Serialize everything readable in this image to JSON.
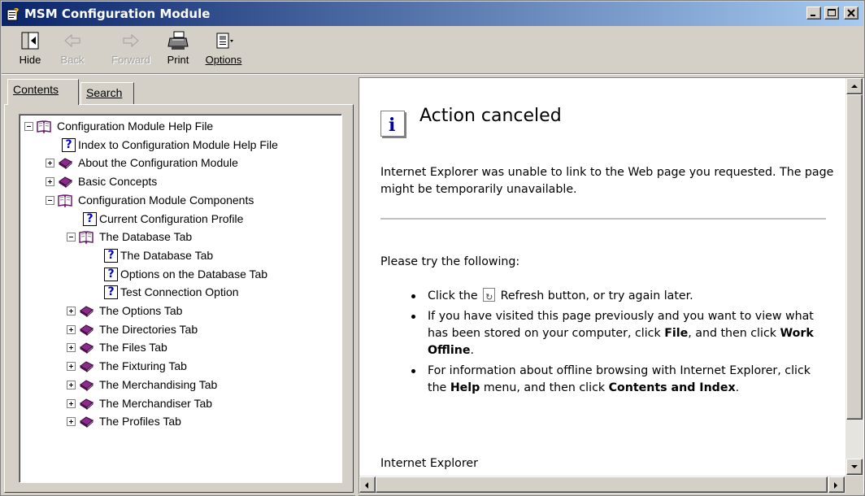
{
  "window": {
    "title": "MSM Configuration Module"
  },
  "toolbar": {
    "hide": "Hide",
    "back": "Back",
    "forward": "Forward",
    "print": "Print",
    "options": "Options"
  },
  "tabs": {
    "contents": "Contents",
    "search": "Search"
  },
  "tree": [
    {
      "label": "Configuration Module Help File",
      "level": 0,
      "icon": "open-book-icon",
      "expander": "minus"
    },
    {
      "label": "Index to Configuration  Module Help File",
      "level": 1,
      "icon": "help-topic-icon",
      "expander": "none"
    },
    {
      "label": "About the Configuration Module",
      "level": 1,
      "icon": "closed-book-icon",
      "expander": "plus"
    },
    {
      "label": "Basic Concepts",
      "level": 1,
      "icon": "closed-book-icon",
      "expander": "plus"
    },
    {
      "label": "Configuration Module Components",
      "level": 1,
      "icon": "open-book-icon",
      "expander": "minus"
    },
    {
      "label": "Current Configuration Profile",
      "level": 2,
      "icon": "help-topic-icon",
      "expander": "none"
    },
    {
      "label": "The Database Tab",
      "level": 2,
      "icon": "open-book-icon",
      "expander": "minus"
    },
    {
      "label": "The Database Tab",
      "level": 3,
      "icon": "help-topic-icon",
      "expander": "none"
    },
    {
      "label": "Options on the Database Tab",
      "level": 3,
      "icon": "help-topic-icon",
      "expander": "none"
    },
    {
      "label": "Test Connection Option",
      "level": 3,
      "icon": "help-topic-icon",
      "expander": "none"
    },
    {
      "label": "The Options Tab",
      "level": 2,
      "icon": "closed-book-icon",
      "expander": "plus"
    },
    {
      "label": "The Directories Tab",
      "level": 2,
      "icon": "closed-book-icon",
      "expander": "plus"
    },
    {
      "label": "The Files Tab",
      "level": 2,
      "icon": "closed-book-icon",
      "expander": "plus"
    },
    {
      "label": "The Fixturing Tab",
      "level": 2,
      "icon": "closed-book-icon",
      "expander": "plus"
    },
    {
      "label": "The Merchandising Tab",
      "level": 2,
      "icon": "closed-book-icon",
      "expander": "plus"
    },
    {
      "label": "The Merchandiser Tab",
      "level": 2,
      "icon": "closed-book-icon",
      "expander": "plus"
    },
    {
      "label": "The Profiles Tab",
      "level": 2,
      "icon": "closed-book-icon",
      "expander": "plus"
    }
  ],
  "content": {
    "icon_glyph": "i",
    "heading": "Action canceled",
    "intro": "Internet Explorer was unable to link to the Web page you requested. The page might be temporarily unavailable.",
    "try_following": "Please try the following:",
    "bullet1_pre": "Click the",
    "bullet1_post": "Refresh button, or try again later.",
    "bullet2_pre": "If you have visited this page previously and you want to view what has been stored on your computer, click",
    "bullet2_file": "File",
    "bullet2_mid": ", and then click",
    "bullet2_offline": "Work Offline",
    "bullet2_end": ".",
    "bullet3_pre": "For information about offline browsing with Internet Explorer, click the",
    "bullet3_help": "Help",
    "bullet3_mid": "menu, and then click",
    "bullet3_contents": "Contents and Index",
    "bullet3_end": ".",
    "footer": "Internet Explorer"
  }
}
